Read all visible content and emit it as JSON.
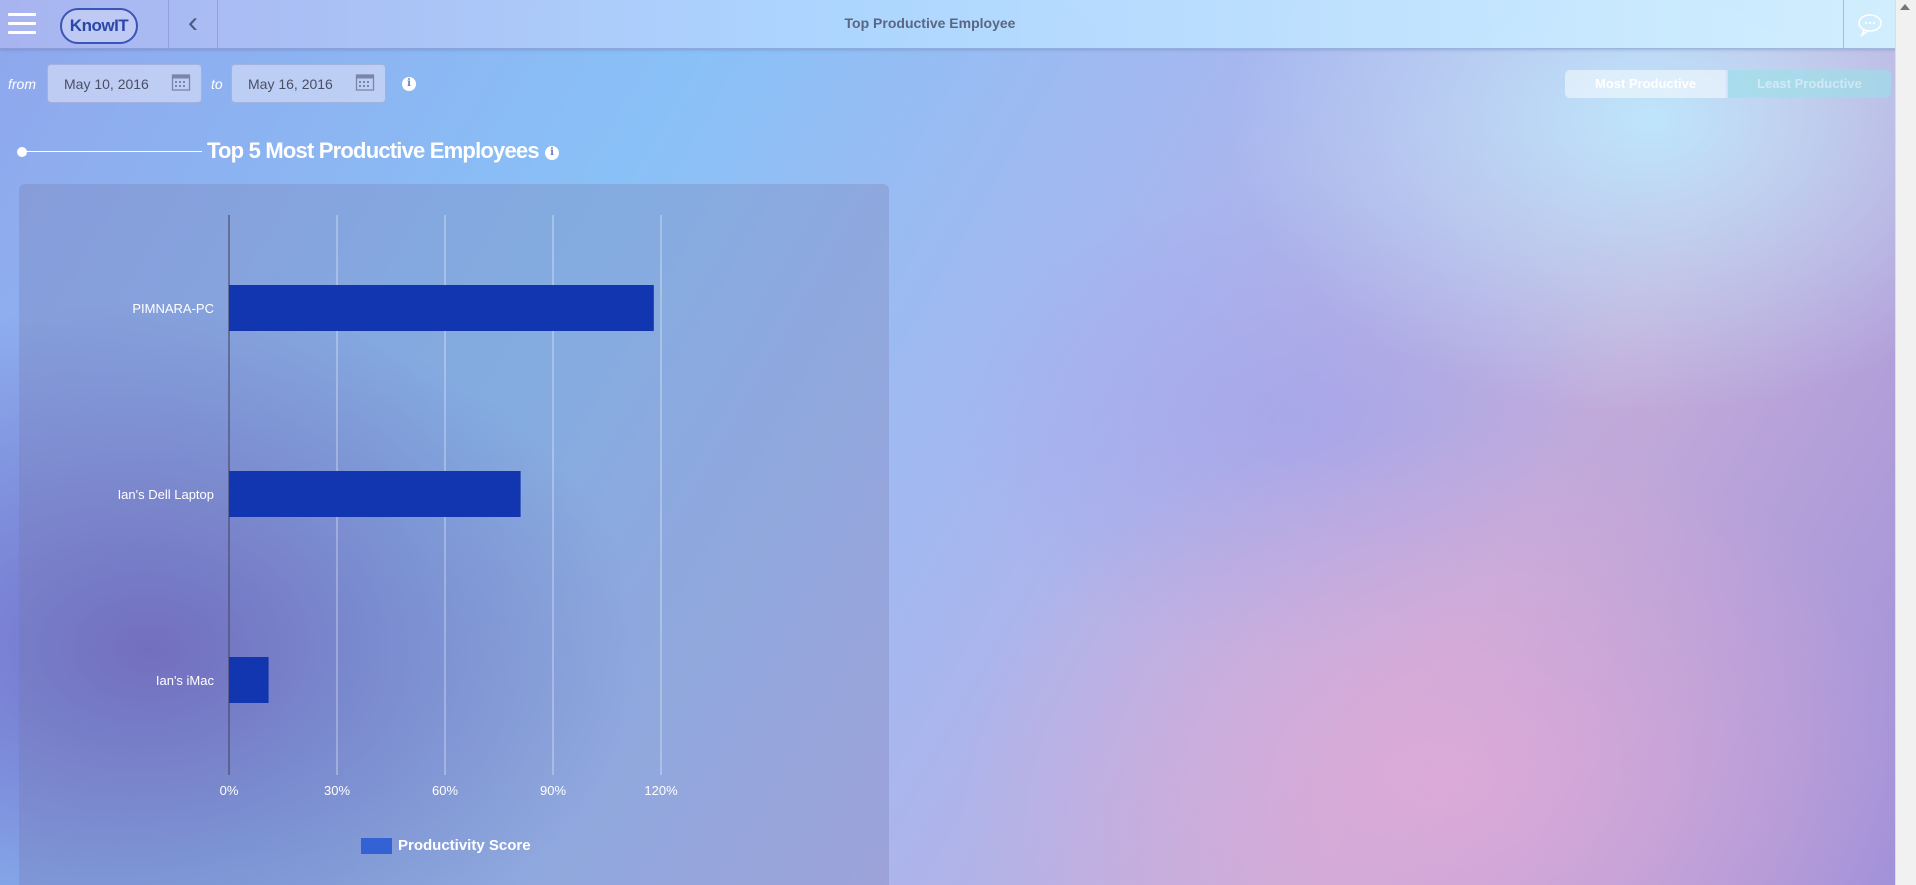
{
  "header": {
    "title": "Top Productive Employee",
    "logo_text": "KnowIT",
    "back_glyph": "‹"
  },
  "filters": {
    "from_label": "from",
    "to_label": "to",
    "from_date": "May 10, 2016",
    "to_date": "May 16, 2016"
  },
  "toggle": {
    "active": "Most Productive",
    "inactive": "Least Productive"
  },
  "section": {
    "title": "Top 5 Most Productive Employees"
  },
  "icons": {
    "menu": "hamburger-icon",
    "back": "chevron-left-icon",
    "chat": "chat-bubble-icon",
    "calendar": "calendar-icon",
    "info": "info-icon"
  },
  "colors": {
    "bar": "#1236b0",
    "legend": "#3461d3",
    "grid": "rgba(255,255,255,0.55)"
  },
  "chart_data": {
    "type": "bar",
    "orientation": "horizontal",
    "categories": [
      "PIMNARA-PC",
      "Ian's Dell Laptop",
      "Ian's iMac"
    ],
    "series": [
      {
        "name": "Productivity Score",
        "values": [
          118,
          81,
          11
        ]
      }
    ],
    "xlim": [
      0,
      150
    ],
    "xticks": [
      "0%",
      "30%",
      "60%",
      "90%",
      "120%"
    ],
    "xtick_values": [
      0,
      30,
      60,
      90,
      120
    ],
    "grid": true,
    "legend": "bottom"
  }
}
